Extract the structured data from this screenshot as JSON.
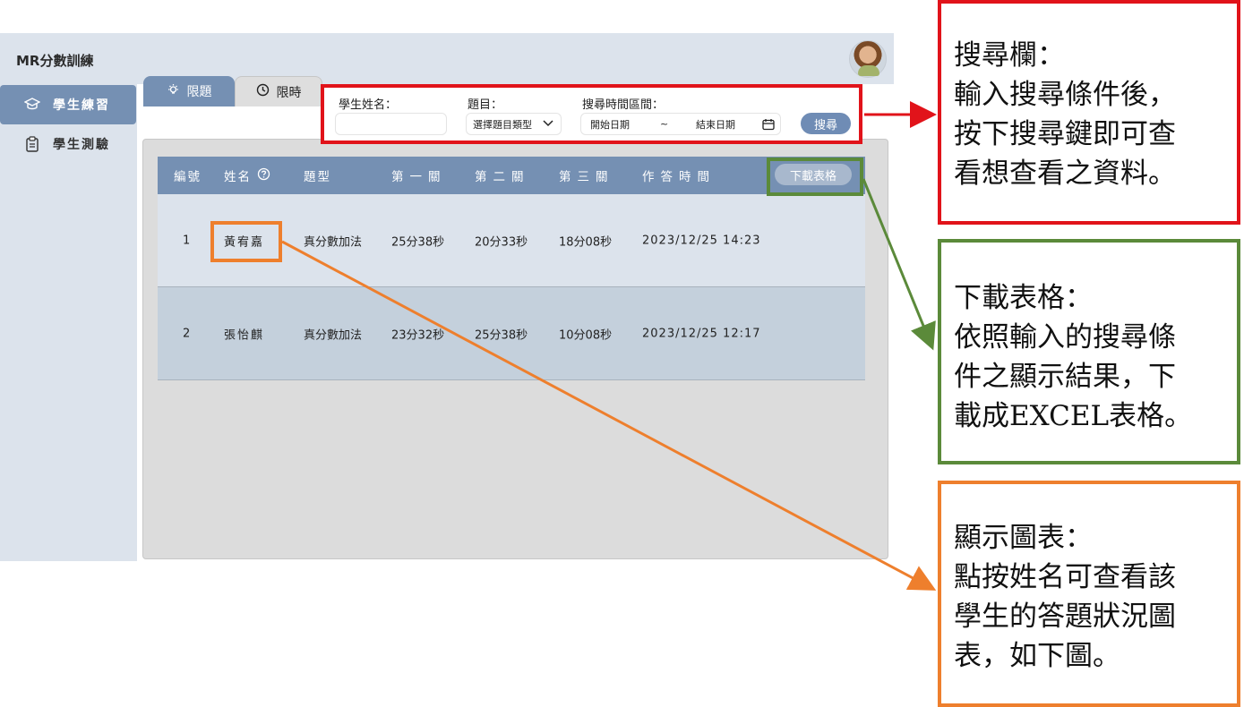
{
  "app": {
    "title": "MR分數訓練"
  },
  "sidebar": {
    "items": [
      {
        "label": "學生練習",
        "icon": "graduation-cap-icon"
      },
      {
        "label": "學生測驗",
        "icon": "clipboard-icon"
      }
    ]
  },
  "tabs": [
    {
      "label": "限題",
      "icon": "lightbulb-icon"
    },
    {
      "label": "限時",
      "icon": "clock-icon"
    }
  ],
  "search": {
    "student_label": "學生姓名：",
    "student_value": "",
    "topic_label": "題目：",
    "topic_value": "選擇題目類型",
    "range_label": "搜尋時間區間：",
    "start_placeholder": "開始日期",
    "separator": "~",
    "end_placeholder": "結束日期",
    "button": "搜尋"
  },
  "table": {
    "headers": [
      "編號",
      "姓名",
      "題型",
      "第一關",
      "第二關",
      "第三關",
      "作答時間"
    ],
    "download_button": "下載表格",
    "rows": [
      [
        "1",
        "黃宥嘉",
        "真分數加法",
        "25分38秒",
        "20分33秒",
        "18分08秒",
        "2023/12/25 14:23"
      ],
      [
        "2",
        "張怡麒",
        "真分數加法",
        "23分32秒",
        "25分38秒",
        "10分08秒",
        "2023/12/25 12:17"
      ]
    ]
  },
  "annotations": {
    "search": [
      "搜尋欄：",
      "輸入搜尋條件後，",
      "按下搜尋鍵即可查",
      "看想查看之資料。"
    ],
    "download": [
      "下載表格：",
      "依照輸入的搜尋條",
      "件之顯示結果，下",
      "載成EXCEL表格。"
    ],
    "chart": [
      "顯示圖表：",
      "點按姓名可查看該",
      "學生的答題狀況圖",
      "表，如下圖。"
    ]
  },
  "colors": {
    "accent": "#7590b3",
    "red": "#e1131a",
    "green": "#5b8a3a",
    "orange": "#ee7f2d"
  }
}
